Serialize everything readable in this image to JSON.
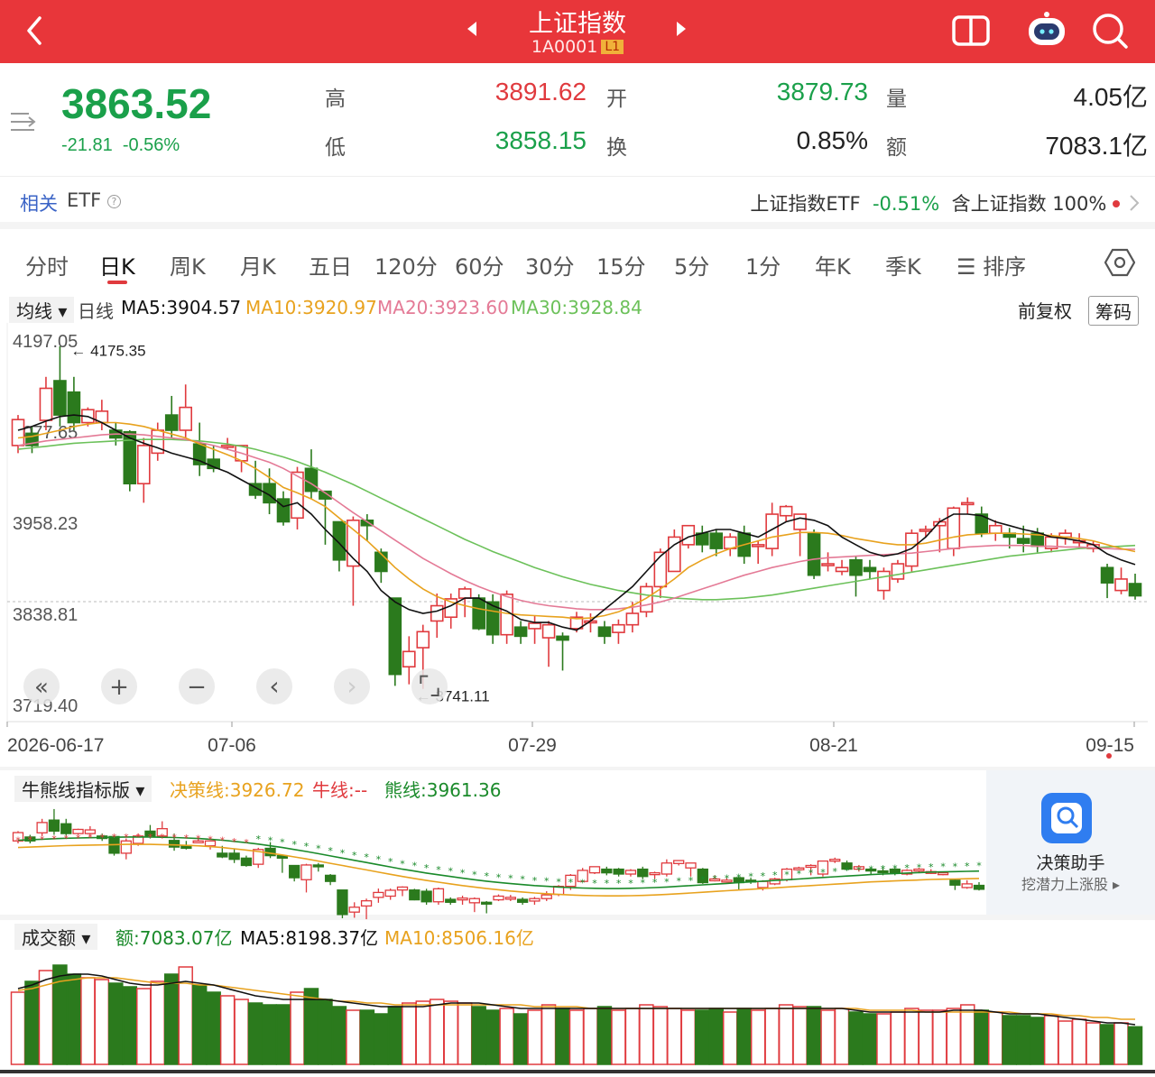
{
  "header": {
    "title": "上证指数",
    "code": "1A0001",
    "level": "L1"
  },
  "quote": {
    "price": "3863.52",
    "change": "-21.81",
    "change_pct": "-0.56%",
    "high_label": "高",
    "high": "3891.62",
    "open_label": "开",
    "open": "3879.73",
    "volume_label": "量",
    "volume": "4.05亿",
    "low_label": "低",
    "low": "3858.15",
    "turnover_label": "换",
    "turnover": "0.85%",
    "amount_label": "额",
    "amount": "7083.1亿"
  },
  "etf": {
    "tag": "相关",
    "tag2": "ETF",
    "name": "上证指数ETF",
    "pct": "-0.51%",
    "holding": "含上证指数 100%"
  },
  "tabs": [
    "分时",
    "日K",
    "周K",
    "月K",
    "五日",
    "120分",
    "60分",
    "30分",
    "15分",
    "5分",
    "1分",
    "年K",
    "季K",
    "☰ 排序"
  ],
  "ma_bar": {
    "selector": "均线",
    "line": "日线",
    "ma5": "MA5:3904.57",
    "ma10": "MA10:3920.97",
    "ma20": "MA20:3923.60",
    "ma30": "MA30:3928.84",
    "adjust": "前复权",
    "chips": "筹码"
  },
  "colors": {
    "up": "#e03a3e",
    "down": "#2b7a1d",
    "ma5": "#111111",
    "ma10": "#e8a21e",
    "ma20": "#e47a96",
    "ma30": "#6cc15a"
  },
  "chart_data": [
    {
      "type": "candlestick",
      "title": "日K",
      "yaxis_ticks": [
        "4197.05",
        "4077.65",
        "3958.23",
        "3838.81",
        "3719.40"
      ],
      "ylim": [
        3719.4,
        4197.05
      ],
      "x_ticks": [
        "2026-06-17",
        "07-06",
        "07-29",
        "08-21",
        "09-15"
      ],
      "max_label": "4175.35",
      "min_label": "3741.11",
      "candles": [
        [
          4060,
          4094,
          4050,
          4100
        ],
        [
          4076,
          4060,
          4050,
          4085
        ],
        [
          4093,
          4135,
          4080,
          4150
        ],
        [
          4145,
          4100,
          4085,
          4190
        ],
        [
          4130,
          4090,
          4080,
          4150
        ],
        [
          4090,
          4107,
          4085,
          4110
        ],
        [
          4090,
          4105,
          4080,
          4120
        ],
        [
          4080,
          4070,
          4060,
          4090
        ],
        [
          4078,
          4010,
          4000,
          4080
        ],
        [
          4010,
          4060,
          3985,
          4070
        ],
        [
          4050,
          4080,
          4040,
          4090
        ],
        [
          4100,
          4080,
          4070,
          4125
        ],
        [
          4080,
          4110,
          4070,
          4140
        ],
        [
          4062,
          4035,
          4020,
          4090
        ],
        [
          4042,
          4030,
          4025,
          4060
        ],
        [
          4060,
          4060,
          4055,
          4070
        ],
        [
          4040,
          4060,
          4025,
          4060
        ],
        [
          4010,
          3995,
          3990,
          4040
        ],
        [
          4010,
          3985,
          3970,
          4030
        ],
        [
          3990,
          3960,
          3955,
          4000
        ],
        [
          3965,
          4025,
          3950,
          4032
        ],
        [
          4030,
          4000,
          3990,
          4055
        ],
        [
          4000,
          3990,
          3930,
          4000
        ],
        [
          3960,
          3910,
          3895,
          3960
        ],
        [
          3902,
          3962,
          3850,
          3967
        ],
        [
          3962,
          3955,
          3935,
          3970
        ],
        [
          3920,
          3895,
          3880,
          3925
        ],
        [
          3860,
          3760,
          3745,
          3860
        ],
        [
          3770,
          3790,
          3747,
          3810
        ],
        [
          3795,
          3816,
          3741,
          3825
        ],
        [
          3830,
          3850,
          3808,
          3866
        ],
        [
          3835,
          3859,
          3820,
          3866
        ],
        [
          3860,
          3872,
          3835,
          3875
        ],
        [
          3860,
          3820,
          3818,
          3865
        ],
        [
          3855,
          3812,
          3800,
          3865
        ],
        [
          3812,
          3865,
          3800,
          3870
        ],
        [
          3822,
          3810,
          3800,
          3830
        ],
        [
          3820,
          3827,
          3800,
          3837
        ],
        [
          3808,
          3825,
          3770,
          3830
        ],
        [
          3810,
          3805,
          3765,
          3815
        ],
        [
          3820,
          3835,
          3815,
          3842
        ],
        [
          3830,
          3830,
          3815,
          3840
        ],
        [
          3822,
          3810,
          3800,
          3830
        ],
        [
          3815,
          3825,
          3800,
          3832
        ],
        [
          3825,
          3840,
          3815,
          3855
        ],
        [
          3842,
          3875,
          3835,
          3880
        ],
        [
          3875,
          3920,
          3860,
          3925
        ],
        [
          3895,
          3940,
          3895,
          3950
        ],
        [
          3930,
          3955,
          3925,
          3955
        ],
        [
          3945,
          3930,
          3920,
          3955
        ],
        [
          3945,
          3925,
          3915,
          3950
        ],
        [
          3925,
          3940,
          3915,
          3945
        ],
        [
          3945,
          3915,
          3905,
          3955
        ],
        [
          3930,
          3930,
          3905,
          3935
        ],
        [
          3925,
          3970,
          3915,
          3985
        ],
        [
          3968,
          3980,
          3960,
          3982
        ],
        [
          3950,
          3970,
          3915,
          3970
        ],
        [
          3945,
          3890,
          3885,
          3950
        ],
        [
          3905,
          3905,
          3895,
          3920
        ],
        [
          3895,
          3900,
          3890,
          3910
        ],
        [
          3910,
          3890,
          3862,
          3915
        ],
        [
          3900,
          3895,
          3885,
          3910
        ],
        [
          3870,
          3895,
          3858,
          3900
        ],
        [
          3885,
          3905,
          3880,
          3910
        ],
        [
          3902,
          3945,
          3895,
          3950
        ],
        [
          3948,
          3950,
          3940,
          3955
        ],
        [
          3955,
          3960,
          3920,
          3965
        ],
        [
          3925,
          3978,
          3915,
          3980
        ],
        [
          3985,
          3985,
          3970,
          3992
        ],
        [
          3970,
          3945,
          3940,
          3980
        ],
        [
          3945,
          3955,
          3935,
          3962
        ],
        [
          3945,
          3940,
          3925,
          3952
        ],
        [
          3938,
          3932,
          3920,
          3955
        ],
        [
          3945,
          3928,
          3920,
          3952
        ],
        [
          3925,
          3940,
          3920,
          3945
        ],
        [
          3940,
          3945,
          3930,
          3950
        ],
        [
          3935,
          3935,
          3925,
          3945
        ],
        [
          3925,
          3930,
          3920,
          3935
        ],
        [
          3900,
          3880,
          3860,
          3905
        ],
        [
          3870,
          3885,
          3865,
          3900
        ],
        [
          3879,
          3863,
          3858,
          3892
        ]
      ],
      "ma5": [
        4080,
        4085,
        4092,
        4098,
        4100,
        4098,
        4090,
        4080,
        4070,
        4063,
        4057,
        4050,
        4045,
        4040,
        4032,
        4025,
        4015,
        4005,
        3995,
        3980,
        3985,
        3970,
        3950,
        3932,
        3912,
        3895,
        3870,
        3855,
        3845,
        3840,
        3843,
        3850,
        3860,
        3860,
        3850,
        3843,
        3832,
        3828,
        3828,
        3822,
        3818,
        3830,
        3845,
        3860,
        3875,
        3895,
        3915,
        3930,
        3940,
        3945,
        3950,
        3950,
        3945,
        3940,
        3950,
        3960,
        3965,
        3962,
        3955,
        3940,
        3930,
        3920,
        3915,
        3918,
        3925,
        3940,
        3960,
        3970,
        3970,
        3968,
        3960,
        3955,
        3950,
        3946,
        3940,
        3938,
        3935,
        3930,
        3918,
        3910,
        3904
      ],
      "ma10": [
        4070,
        4072,
        4076,
        4080,
        4085,
        4088,
        4090,
        4090,
        4088,
        4085,
        4080,
        4075,
        4070,
        4062,
        4055,
        4048,
        4040,
        4030,
        4018,
        4005,
        3998,
        3990,
        3980,
        3965,
        3950,
        3935,
        3918,
        3900,
        3885,
        3872,
        3862,
        3855,
        3850,
        3846,
        3843,
        3840,
        3838,
        3837,
        3836,
        3835,
        3833,
        3834,
        3837,
        3842,
        3850,
        3860,
        3872,
        3885,
        3900,
        3910,
        3918,
        3925,
        3930,
        3935,
        3940,
        3943,
        3946,
        3946,
        3945,
        3942,
        3938,
        3935,
        3932,
        3930,
        3930,
        3932,
        3936,
        3940,
        3943,
        3944,
        3945,
        3945,
        3944,
        3943,
        3942,
        3940,
        3938,
        3935,
        3930,
        3925,
        3921
      ],
      "ma20": [
        4060,
        4063,
        4066,
        4068,
        4070,
        4072,
        4074,
        4075,
        4075,
        4074,
        4072,
        4070,
        4068,
        4064,
        4060,
        4055,
        4050,
        4044,
        4038,
        4030,
        4020,
        4010,
        3998,
        3985,
        3972,
        3960,
        3948,
        3936,
        3924,
        3912,
        3902,
        3892,
        3883,
        3875,
        3868,
        3862,
        3857,
        3853,
        3850,
        3848,
        3846,
        3845,
        3845,
        3846,
        3848,
        3851,
        3855,
        3860,
        3866,
        3872,
        3878,
        3884,
        3890,
        3895,
        3900,
        3904,
        3908,
        3911,
        3913,
        3914,
        3915,
        3916,
        3917,
        3918,
        3919,
        3921,
        3923,
        3925,
        3927,
        3928,
        3929,
        3929,
        3929,
        3928,
        3928,
        3927,
        3927,
        3926,
        3925,
        3924,
        3924
      ],
      "ma30": [
        4055,
        4057,
        4059,
        4061,
        4063,
        4064,
        4065,
        4066,
        4067,
        4068,
        4068,
        4068,
        4067,
        4066,
        4064,
        4062,
        4059,
        4055,
        4050,
        4045,
        4039,
        4032,
        4025,
        4017,
        4009,
        4000,
        3991,
        3982,
        3973,
        3964,
        3955,
        3946,
        3937,
        3929,
        3921,
        3914,
        3907,
        3900,
        3894,
        3888,
        3883,
        3878,
        3874,
        3870,
        3867,
        3864,
        3862,
        3860,
        3859,
        3858,
        3858,
        3859,
        3860,
        3862,
        3864,
        3867,
        3870,
        3873,
        3876,
        3879,
        3882,
        3885,
        3888,
        3891,
        3894,
        3897,
        3900,
        3903,
        3906,
        3909,
        3912,
        3915,
        3917,
        3919,
        3921,
        3923,
        3925,
        3926,
        3927,
        3928,
        3929
      ]
    },
    {
      "type": "indicator",
      "title": "牛熊线指标版",
      "legend": [
        "决策线:3926.72",
        "牛线:--",
        "熊线:3961.36"
      ]
    },
    {
      "type": "bar",
      "title": "成交额",
      "legend": [
        "额:7083.07亿",
        "MA5:8198.37亿",
        "MA10:8506.16亿"
      ],
      "values": [
        9000,
        9600,
        10200,
        10500,
        10000,
        9800,
        9700,
        9500,
        9300,
        9200,
        9600,
        10000,
        10400,
        9400,
        9000,
        8800,
        8600,
        8400,
        8300,
        8300,
        9000,
        9200,
        8600,
        8200,
        8000,
        8000,
        7800,
        8200,
        8400,
        8500,
        8600,
        8500,
        8400,
        8200,
        8000,
        8100,
        7800,
        8000,
        8300,
        8100,
        8000,
        8100,
        8200,
        8000,
        8100,
        8300,
        8200,
        8100,
        8000,
        8000,
        8100,
        7900,
        8100,
        8000,
        8100,
        8300,
        8200,
        8200,
        8000,
        8100,
        7900,
        7800,
        7800,
        7900,
        8100,
        8000,
        8000,
        8100,
        8300,
        8000,
        7900,
        7700,
        7700,
        7600,
        7700,
        7400,
        7500,
        7300,
        7200,
        7300,
        7083
      ],
      "ma5": [
        9200,
        9400,
        9700,
        9900,
        10000,
        10000,
        9900,
        9700,
        9500,
        9400,
        9400,
        9500,
        9600,
        9500,
        9400,
        9200,
        9000,
        8800,
        8700,
        8600,
        8600,
        8600,
        8600,
        8500,
        8400,
        8300,
        8200,
        8200,
        8200,
        8200,
        8300,
        8400,
        8400,
        8400,
        8300,
        8200,
        8100,
        8100,
        8100,
        8100,
        8100,
        8100,
        8100,
        8100,
        8100,
        8100,
        8100,
        8100,
        8100,
        8100,
        8100,
        8100,
        8100,
        8100,
        8100,
        8100,
        8100,
        8100,
        8100,
        8100,
        8000,
        7900,
        7900,
        7900,
        7900,
        7900,
        7900,
        8000,
        8000,
        8000,
        7900,
        7800,
        7800,
        7800,
        7700,
        7600,
        7500,
        7400,
        7300,
        7300,
        7200
      ],
      "ma10": [
        9100,
        9200,
        9400,
        9600,
        9700,
        9800,
        9800,
        9800,
        9700,
        9600,
        9500,
        9500,
        9500,
        9400,
        9400,
        9300,
        9200,
        9100,
        9000,
        8900,
        8800,
        8700,
        8600,
        8500,
        8500,
        8400,
        8400,
        8300,
        8300,
        8300,
        8300,
        8300,
        8300,
        8300,
        8300,
        8300,
        8300,
        8200,
        8200,
        8200,
        8200,
        8100,
        8100,
        8100,
        8100,
        8100,
        8100,
        8100,
        8100,
        8100,
        8100,
        8100,
        8100,
        8100,
        8100,
        8100,
        8100,
        8100,
        8100,
        8100,
        8100,
        8000,
        8000,
        8000,
        8000,
        7900,
        7900,
        7900,
        7900,
        7900,
        7900,
        7900,
        7800,
        7800,
        7800,
        7700,
        7700,
        7600,
        7600,
        7500,
        7500
      ]
    }
  ],
  "side_ad": {
    "title": "决策助手",
    "subtitle": "挖潜力上涨股 ▸"
  },
  "zoom_controls": [
    "«",
    "+",
    "−",
    "‹",
    "›",
    "⌜⌟"
  ]
}
